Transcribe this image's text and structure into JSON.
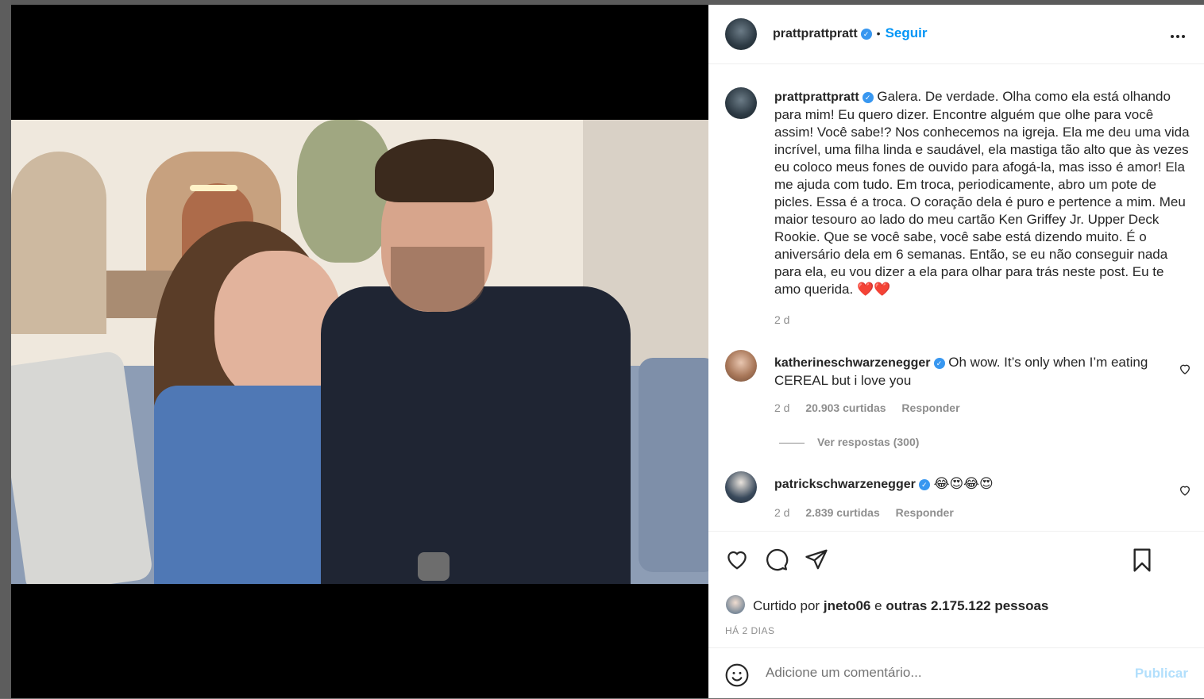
{
  "post": {
    "author": "prattprattpratt",
    "follow_label": "Seguir",
    "separator": "•",
    "caption": "Galera. De verdade. Olha como ela está olhando para mim! Eu quero dizer. Encontre alguém que olhe para você assim! Você sabe!? Nos conhecemos na igreja. Ela me deu uma vida incrível, uma filha linda e saudável, ela mastiga tão alto que às vezes eu coloco meus fones de ouvido para afogá-la, mas isso é amor! Ela me ajuda com tudo. Em troca, periodicamente, abro um pote de picles. Essa é a troca. O coração dela é puro e pertence a mim. Meu maior tesouro ao lado do meu cartão Ken Griffey Jr. Upper Deck Rookie. Que se você sabe, você sabe está dizendo muito. É o aniversário dela em 6 semanas. Então, se eu não conseguir nada para ela, eu vou dizer a ela para olhar para trás neste post. Eu te amo querida.",
    "caption_emoji": "❤️❤️",
    "caption_time": "2 d"
  },
  "comments": [
    {
      "username": "katherineschwarzenegger",
      "text": "Oh wow. It’s only when I’m eating CEREAL but i love you",
      "time": "2 d",
      "likes": "20.903 curtidas",
      "reply": "Responder",
      "view_replies": "Ver respostas (300)"
    },
    {
      "username": "patrickschwarzenegger",
      "text": "😂😍😂😍",
      "time": "2 d",
      "likes": "2.839 curtidas",
      "reply": "Responder"
    }
  ],
  "likes": {
    "prefix": "Curtido por",
    "user": "jneto06",
    "conj": "e",
    "others": "outras 2.175.122 pessoas"
  },
  "date_label": "HÁ 2 DIAS",
  "comment_box": {
    "placeholder": "Adicione um comentário...",
    "publish": "Publicar"
  },
  "icons": {
    "more": "more-options-icon",
    "like": "heart-icon",
    "comment": "comment-icon",
    "share": "share-icon",
    "save": "bookmark-icon",
    "emoji": "emoji-icon"
  }
}
